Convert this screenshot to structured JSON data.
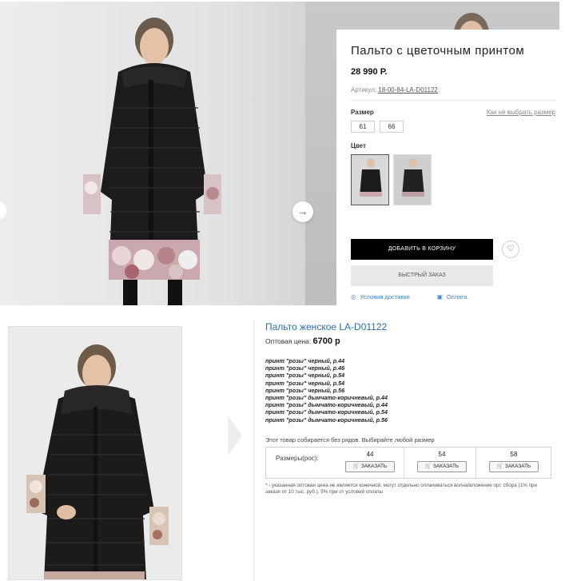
{
  "retail": {
    "title": "Пальто с цветочным принтом",
    "price": "28 990 Р.",
    "article_label": "Артикул:",
    "article_value": "18-00-84-LA-D01122",
    "size_label": "Размер",
    "size_guide_link": "Как не выбрать размер",
    "sizes": [
      "61",
      "66"
    ],
    "color_label": "Цвет",
    "add_to_cart": "ДОБАВИТЬ В КОРЗИНУ",
    "quick_order": "БЫСТРЫЙ ЗАКАЗ",
    "delivery_link": "Условия доставки",
    "payment_link": "Оплата",
    "next_arrow": "→",
    "fav_icon": "♡"
  },
  "wholesale": {
    "title": "Пальто женское LA-D01122",
    "price_label": "Оптовая цена:",
    "price_value": "6700 р",
    "variants": [
      "принт \"розы\" черный, р.44",
      "принт \"розы\" черный, р.46",
      "принт \"розы\" черный, р.54",
      "принт \"розы\" черный, р.54",
      "принт \"розы\" черный, р.56",
      "принт \"розы\" дымчато-коричневый, р.44",
      "принт \"розы\" дымчато-коричневый, р.44",
      "принт \"розы\" дымчато-коричневый, р.54",
      "принт \"розы\" дымчато-коричневый, р.56"
    ],
    "note": "Этот товар собирается без рядов. Выбирайте любой размер",
    "table_header": "Размеры(рос):",
    "sizes": [
      "44",
      "54",
      "58"
    ],
    "order_label": "ЗАКАЗАТЬ",
    "footnote": "* - указанная оптовая цена не является конечной, могут отдельно оплачиваться волна/вложение орг. сбора (1% при заказе от 10 тыс. руб.), 5% при от условий оплаты"
  },
  "colors": {
    "accent": "#2a6fa8",
    "cart_button": "#000000",
    "quick_button": "#e9e9e9"
  }
}
